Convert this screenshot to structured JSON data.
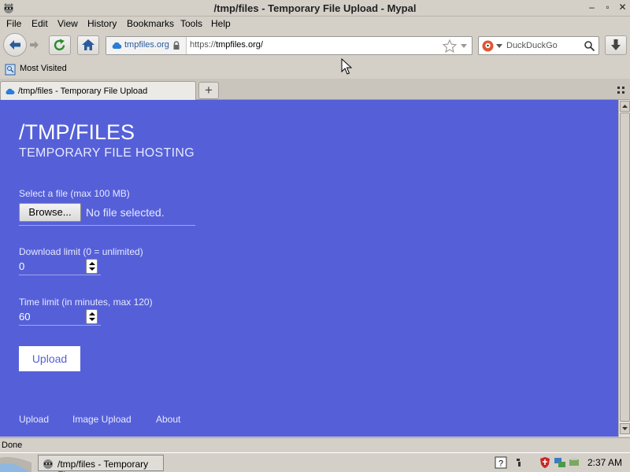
{
  "window": {
    "title": "/tmp/files - Temporary File Upload - Mypal",
    "minimize": "–",
    "restore": "▫",
    "close": "✕"
  },
  "menu": [
    "File",
    "Edit",
    "View",
    "History",
    "Bookmarks",
    "Tools",
    "Help"
  ],
  "nav": {
    "site_label": "tmpfiles.org",
    "url_prefix": "https://",
    "url_host": "tmpfiles.org/",
    "search_placeholder": "DuckDuckGo"
  },
  "bookmarks": {
    "most_visited": "Most Visited"
  },
  "tab": {
    "label": "/tmp/files - Temporary File Upload",
    "new_tab": "+"
  },
  "page": {
    "title": "/TMP/FILES",
    "subtitle": "TEMPORARY FILE HOSTING",
    "file_label": "Select a file (max 100 MB)",
    "browse": "Browse...",
    "no_file": "No file selected.",
    "download_limit_label": "Download limit (0 = unlimited)",
    "download_limit_value": "0",
    "time_limit_label": "Time limit (in minutes, max 120)",
    "time_limit_value": "60",
    "upload": "Upload",
    "footer": [
      "Upload",
      "Image Upload",
      "About"
    ]
  },
  "status": "Done",
  "taskbar": {
    "task": "/tmp/files - Temporary Fi...",
    "clock": "2:37 AM"
  },
  "colors": {
    "page_bg": "#5560d8",
    "chrome_bg": "#d4d0c8"
  }
}
